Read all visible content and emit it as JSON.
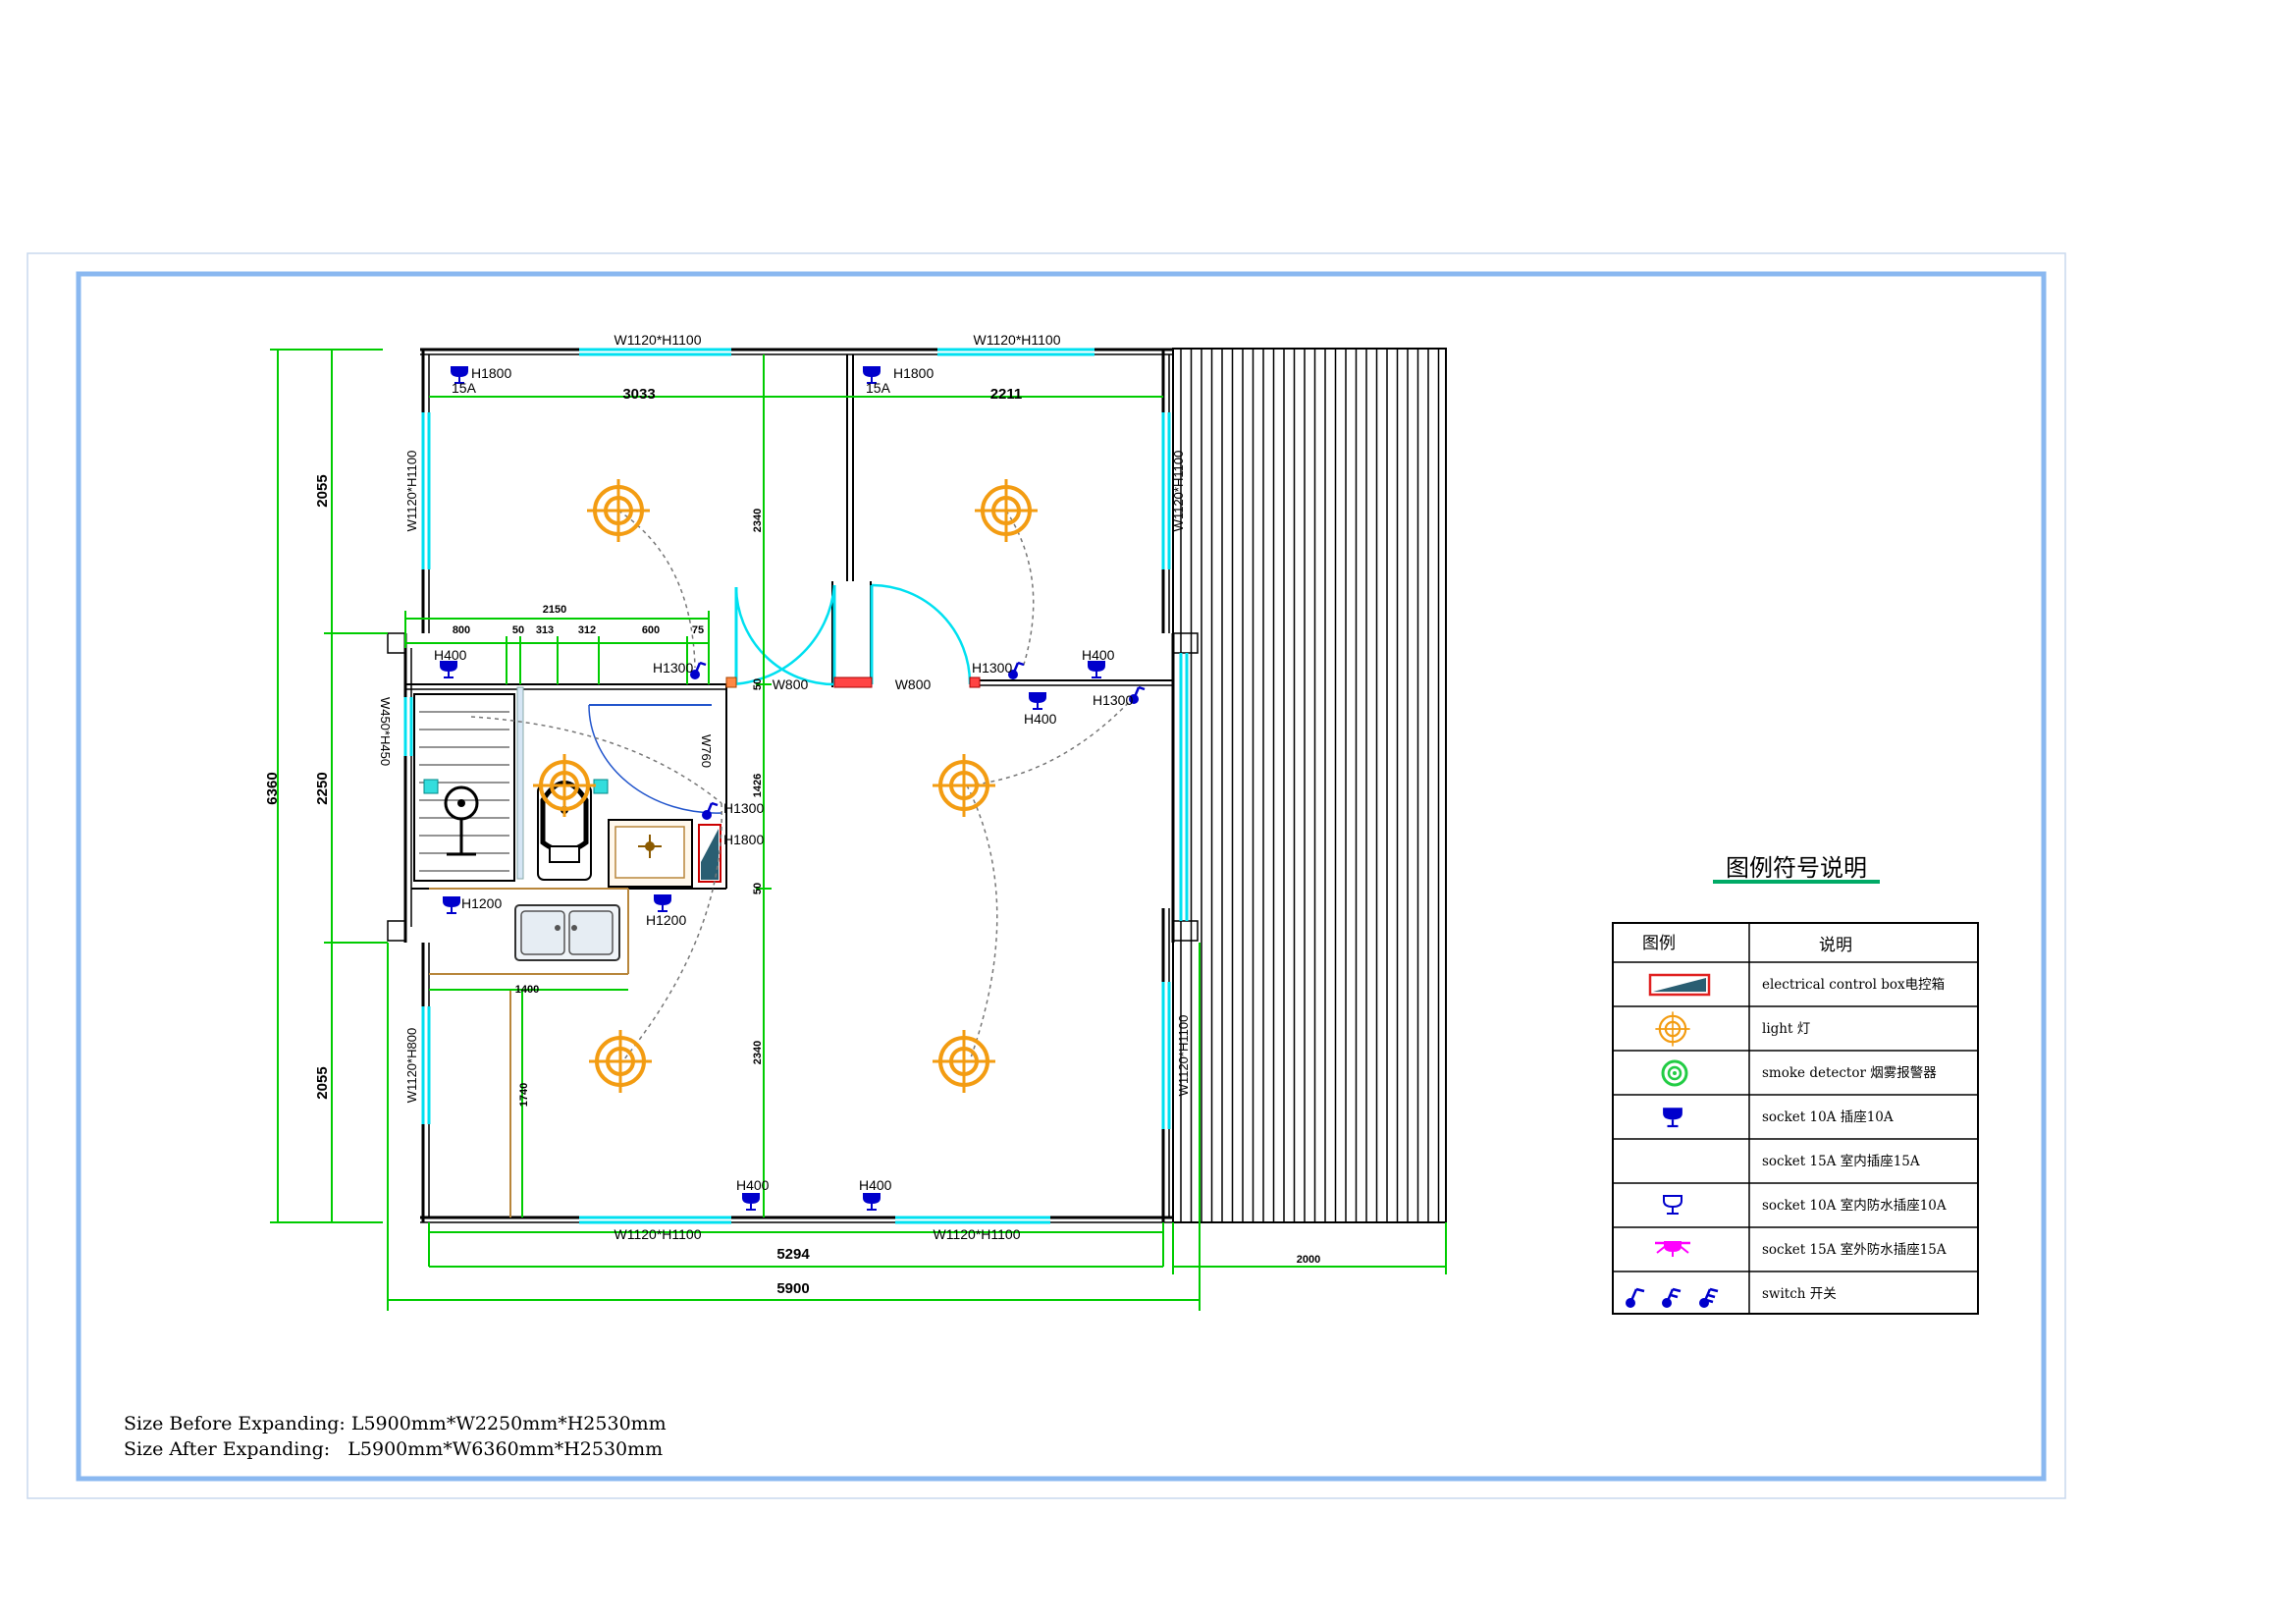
{
  "plan": {
    "windows": {
      "top_left": "W1120*H1100",
      "top_right": "W1120*H1100",
      "left_upper": "W1120*H1100",
      "left_lower": "W1120*H800",
      "right_upper": "W1120*H1100",
      "right_lower": "W1120*H1100",
      "bottom_left": "W1120*H1100",
      "bottom_right": "W1120*H1100",
      "bath": "W450*H450"
    },
    "doors": {
      "d1": "W800",
      "d2": "W800",
      "d3": "W760"
    },
    "dimensions": {
      "total_length": "5900",
      "inner_length": "5294",
      "deck_width": "2000",
      "total_width": "6360",
      "left_top": "2055",
      "left_mid": "2250",
      "left_bottom": "2055",
      "room1_width": "3033",
      "room2_width": "2211",
      "vert_2340_top": "2340",
      "vert_2340_bottom": "2340",
      "vert_50_top": "50",
      "vert_50_bottom": "50",
      "vert_1426": "1426",
      "bath_total": "2150",
      "bath_segments": [
        "800",
        "50",
        "313",
        "312",
        "600",
        "75"
      ],
      "kitchen_width": "1400",
      "kitchen_depth": "1740"
    },
    "heights": {
      "s_tl": "H1800",
      "s_tl_a": "15A",
      "s_tr": "H1800",
      "s_tr_a": "15A",
      "h400_bath": "H400",
      "h1300_a": "H1300",
      "h1300_b": "H1300",
      "h400_r2": "H400",
      "h400_mid": "H400",
      "h1300_c": "H1300",
      "h1300_d": "H1300",
      "h1800_box": "H1800",
      "h1200_a": "H1200",
      "h1200_b": "H1200",
      "h400_bot1": "H400",
      "h400_bot2": "H400"
    }
  },
  "legend": {
    "title": "图例符号说明",
    "col_symbol": "图例",
    "col_desc": "说明",
    "rows": [
      {
        "icon": "electrical-control-box-icon",
        "desc": "electrical  control  box电控箱"
      },
      {
        "icon": "light-icon",
        "desc": "light  灯"
      },
      {
        "icon": "smoke-detector-icon",
        "desc": "smoke  detector  烟雾报警器"
      },
      {
        "icon": "socket-10a-icon",
        "desc": "socket  10A    插座10A"
      },
      {
        "icon": "socket-15a-icon",
        "desc": "socket  15A    室内插座15A"
      },
      {
        "icon": "socket-10a-waterproof-icon",
        "desc": "socket  10A    室内防水插座10A"
      },
      {
        "icon": "socket-15a-outdoor-icon",
        "desc": "socket  15A    室外防水插座15A"
      },
      {
        "icon": "switch-icon",
        "desc": "switch  开关"
      }
    ]
  },
  "notes": {
    "before": "Size Before Expanding: L5900mm*W2250mm*H2530mm",
    "after": "Size After Expanding:   L5900mm*W6360mm*H2530mm"
  },
  "colors": {
    "frame": "#8ab8f0",
    "dimension": "#00cc00",
    "window": "#00e0f0",
    "light": "#f39c12",
    "socket": "#0000cc",
    "smoke": "#22cc44",
    "outdoor": "#ff00ff",
    "cabinet": "#b8863b"
  }
}
